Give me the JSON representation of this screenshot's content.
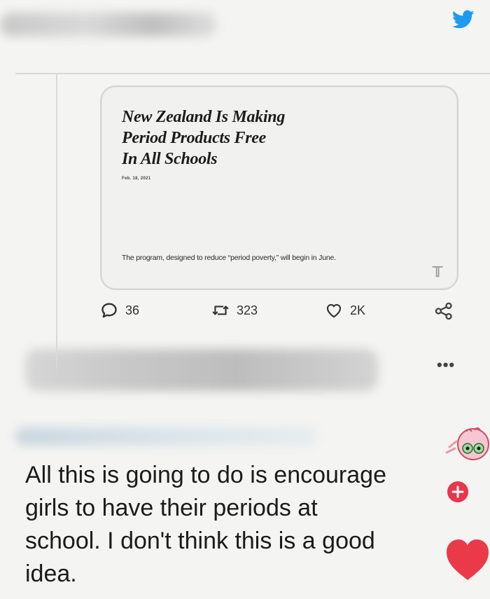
{
  "icons": {
    "twitter": "twitter-bird-icon",
    "reply": "speech-bubble-icon",
    "retweet": "retweet-icon",
    "like": "heart-outline-icon",
    "share": "share-icon",
    "more": "more-dots-icon",
    "sticker": "frog-sticker-icon",
    "reaction": "heart-icon"
  },
  "colors": {
    "twitter_blue": "#1d9bf0",
    "sticker_red": "#e8364d",
    "heart_red": "#ea3a4a"
  },
  "article": {
    "headline_lines": [
      "New Zealand Is Making",
      "Period Products Free",
      "In All Schools"
    ],
    "date": "Feb. 18, 2021",
    "summary": "The program, designed to reduce “period poverty,” will begin in June.",
    "source_mark": "𝕋"
  },
  "actions": {
    "replies": "36",
    "retweets": "323",
    "likes": "2K",
    "more": "•••"
  },
  "comment": {
    "lines": [
      "All this is going to do is encourage",
      "girls to have their periods at",
      "school. I don't think this is a good",
      "idea."
    ]
  }
}
